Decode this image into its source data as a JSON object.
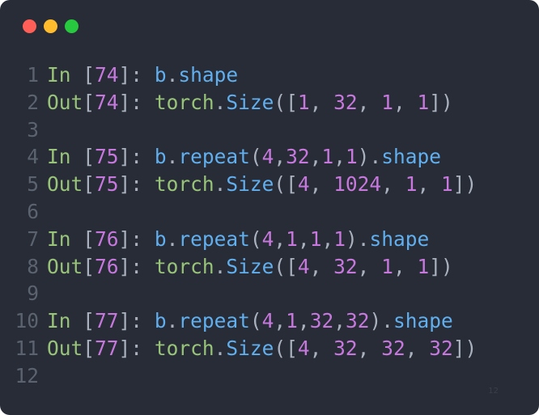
{
  "window": {
    "controls": [
      {
        "name": "close",
        "color": "#ff5f56"
      },
      {
        "name": "minimize",
        "color": "#ffbd2e"
      },
      {
        "name": "maximize",
        "color": "#27c93f"
      }
    ]
  },
  "code_lines": [
    {
      "ln": "1",
      "tokens": [
        {
          "t": "In ",
          "c": "kw"
        },
        {
          "t": "[",
          "c": "punct"
        },
        {
          "t": "74",
          "c": "num"
        },
        {
          "t": "]: ",
          "c": "punct"
        },
        {
          "t": "b",
          "c": "ident"
        },
        {
          "t": ".",
          "c": "punct"
        },
        {
          "t": "shape",
          "c": "ident"
        }
      ]
    },
    {
      "ln": "2",
      "tokens": [
        {
          "t": "Out",
          "c": "kw"
        },
        {
          "t": "[",
          "c": "punct"
        },
        {
          "t": "74",
          "c": "num"
        },
        {
          "t": "]: ",
          "c": "punct"
        },
        {
          "t": "torch",
          "c": "kw"
        },
        {
          "t": ".",
          "c": "punct"
        },
        {
          "t": "Size",
          "c": "ident"
        },
        {
          "t": "([",
          "c": "punct"
        },
        {
          "t": "1",
          "c": "num"
        },
        {
          "t": ", ",
          "c": "punct"
        },
        {
          "t": "32",
          "c": "num"
        },
        {
          "t": ", ",
          "c": "punct"
        },
        {
          "t": "1",
          "c": "num"
        },
        {
          "t": ", ",
          "c": "punct"
        },
        {
          "t": "1",
          "c": "num"
        },
        {
          "t": "])",
          "c": "punct"
        }
      ]
    },
    {
      "ln": "3",
      "tokens": []
    },
    {
      "ln": "4",
      "tokens": [
        {
          "t": "In ",
          "c": "kw"
        },
        {
          "t": "[",
          "c": "punct"
        },
        {
          "t": "75",
          "c": "num"
        },
        {
          "t": "]: ",
          "c": "punct"
        },
        {
          "t": "b",
          "c": "ident"
        },
        {
          "t": ".",
          "c": "punct"
        },
        {
          "t": "repeat",
          "c": "ident"
        },
        {
          "t": "(",
          "c": "punct"
        },
        {
          "t": "4",
          "c": "num"
        },
        {
          "t": ",",
          "c": "punct"
        },
        {
          "t": "32",
          "c": "num"
        },
        {
          "t": ",",
          "c": "punct"
        },
        {
          "t": "1",
          "c": "num"
        },
        {
          "t": ",",
          "c": "punct"
        },
        {
          "t": "1",
          "c": "num"
        },
        {
          "t": ").",
          "c": "punct"
        },
        {
          "t": "shape",
          "c": "ident"
        }
      ]
    },
    {
      "ln": "5",
      "tokens": [
        {
          "t": "Out",
          "c": "kw"
        },
        {
          "t": "[",
          "c": "punct"
        },
        {
          "t": "75",
          "c": "num"
        },
        {
          "t": "]: ",
          "c": "punct"
        },
        {
          "t": "torch",
          "c": "kw"
        },
        {
          "t": ".",
          "c": "punct"
        },
        {
          "t": "Size",
          "c": "ident"
        },
        {
          "t": "([",
          "c": "punct"
        },
        {
          "t": "4",
          "c": "num"
        },
        {
          "t": ", ",
          "c": "punct"
        },
        {
          "t": "1024",
          "c": "num"
        },
        {
          "t": ", ",
          "c": "punct"
        },
        {
          "t": "1",
          "c": "num"
        },
        {
          "t": ", ",
          "c": "punct"
        },
        {
          "t": "1",
          "c": "num"
        },
        {
          "t": "])",
          "c": "punct"
        }
      ]
    },
    {
      "ln": "6",
      "tokens": []
    },
    {
      "ln": "7",
      "tokens": [
        {
          "t": "In ",
          "c": "kw"
        },
        {
          "t": "[",
          "c": "punct"
        },
        {
          "t": "76",
          "c": "num"
        },
        {
          "t": "]: ",
          "c": "punct"
        },
        {
          "t": "b",
          "c": "ident"
        },
        {
          "t": ".",
          "c": "punct"
        },
        {
          "t": "repeat",
          "c": "ident"
        },
        {
          "t": "(",
          "c": "punct"
        },
        {
          "t": "4",
          "c": "num"
        },
        {
          "t": ",",
          "c": "punct"
        },
        {
          "t": "1",
          "c": "num"
        },
        {
          "t": ",",
          "c": "punct"
        },
        {
          "t": "1",
          "c": "num"
        },
        {
          "t": ",",
          "c": "punct"
        },
        {
          "t": "1",
          "c": "num"
        },
        {
          "t": ").",
          "c": "punct"
        },
        {
          "t": "shape",
          "c": "ident"
        }
      ]
    },
    {
      "ln": "8",
      "tokens": [
        {
          "t": "Out",
          "c": "kw"
        },
        {
          "t": "[",
          "c": "punct"
        },
        {
          "t": "76",
          "c": "num"
        },
        {
          "t": "]: ",
          "c": "punct"
        },
        {
          "t": "torch",
          "c": "kw"
        },
        {
          "t": ".",
          "c": "punct"
        },
        {
          "t": "Size",
          "c": "ident"
        },
        {
          "t": "([",
          "c": "punct"
        },
        {
          "t": "4",
          "c": "num"
        },
        {
          "t": ", ",
          "c": "punct"
        },
        {
          "t": "32",
          "c": "num"
        },
        {
          "t": ", ",
          "c": "punct"
        },
        {
          "t": "1",
          "c": "num"
        },
        {
          "t": ", ",
          "c": "punct"
        },
        {
          "t": "1",
          "c": "num"
        },
        {
          "t": "])",
          "c": "punct"
        }
      ]
    },
    {
      "ln": "9",
      "tokens": []
    },
    {
      "ln": "10",
      "tokens": [
        {
          "t": "In ",
          "c": "kw"
        },
        {
          "t": "[",
          "c": "punct"
        },
        {
          "t": "77",
          "c": "num"
        },
        {
          "t": "]: ",
          "c": "punct"
        },
        {
          "t": "b",
          "c": "ident"
        },
        {
          "t": ".",
          "c": "punct"
        },
        {
          "t": "repeat",
          "c": "ident"
        },
        {
          "t": "(",
          "c": "punct"
        },
        {
          "t": "4",
          "c": "num"
        },
        {
          "t": ",",
          "c": "punct"
        },
        {
          "t": "1",
          "c": "num"
        },
        {
          "t": ",",
          "c": "punct"
        },
        {
          "t": "32",
          "c": "num"
        },
        {
          "t": ",",
          "c": "punct"
        },
        {
          "t": "32",
          "c": "num"
        },
        {
          "t": ").",
          "c": "punct"
        },
        {
          "t": "shape",
          "c": "ident"
        }
      ]
    },
    {
      "ln": "11",
      "tokens": [
        {
          "t": "Out",
          "c": "kw"
        },
        {
          "t": "[",
          "c": "punct"
        },
        {
          "t": "77",
          "c": "num"
        },
        {
          "t": "]: ",
          "c": "punct"
        },
        {
          "t": "torch",
          "c": "kw"
        },
        {
          "t": ".",
          "c": "punct"
        },
        {
          "t": "Size",
          "c": "ident"
        },
        {
          "t": "([",
          "c": "punct"
        },
        {
          "t": "4",
          "c": "num"
        },
        {
          "t": ", ",
          "c": "punct"
        },
        {
          "t": "32",
          "c": "num"
        },
        {
          "t": ", ",
          "c": "punct"
        },
        {
          "t": "32",
          "c": "num"
        },
        {
          "t": ", ",
          "c": "punct"
        },
        {
          "t": "32",
          "c": "num"
        },
        {
          "t": "])",
          "c": "punct"
        }
      ]
    },
    {
      "ln": "12",
      "tokens": []
    }
  ],
  "watermark": "12"
}
